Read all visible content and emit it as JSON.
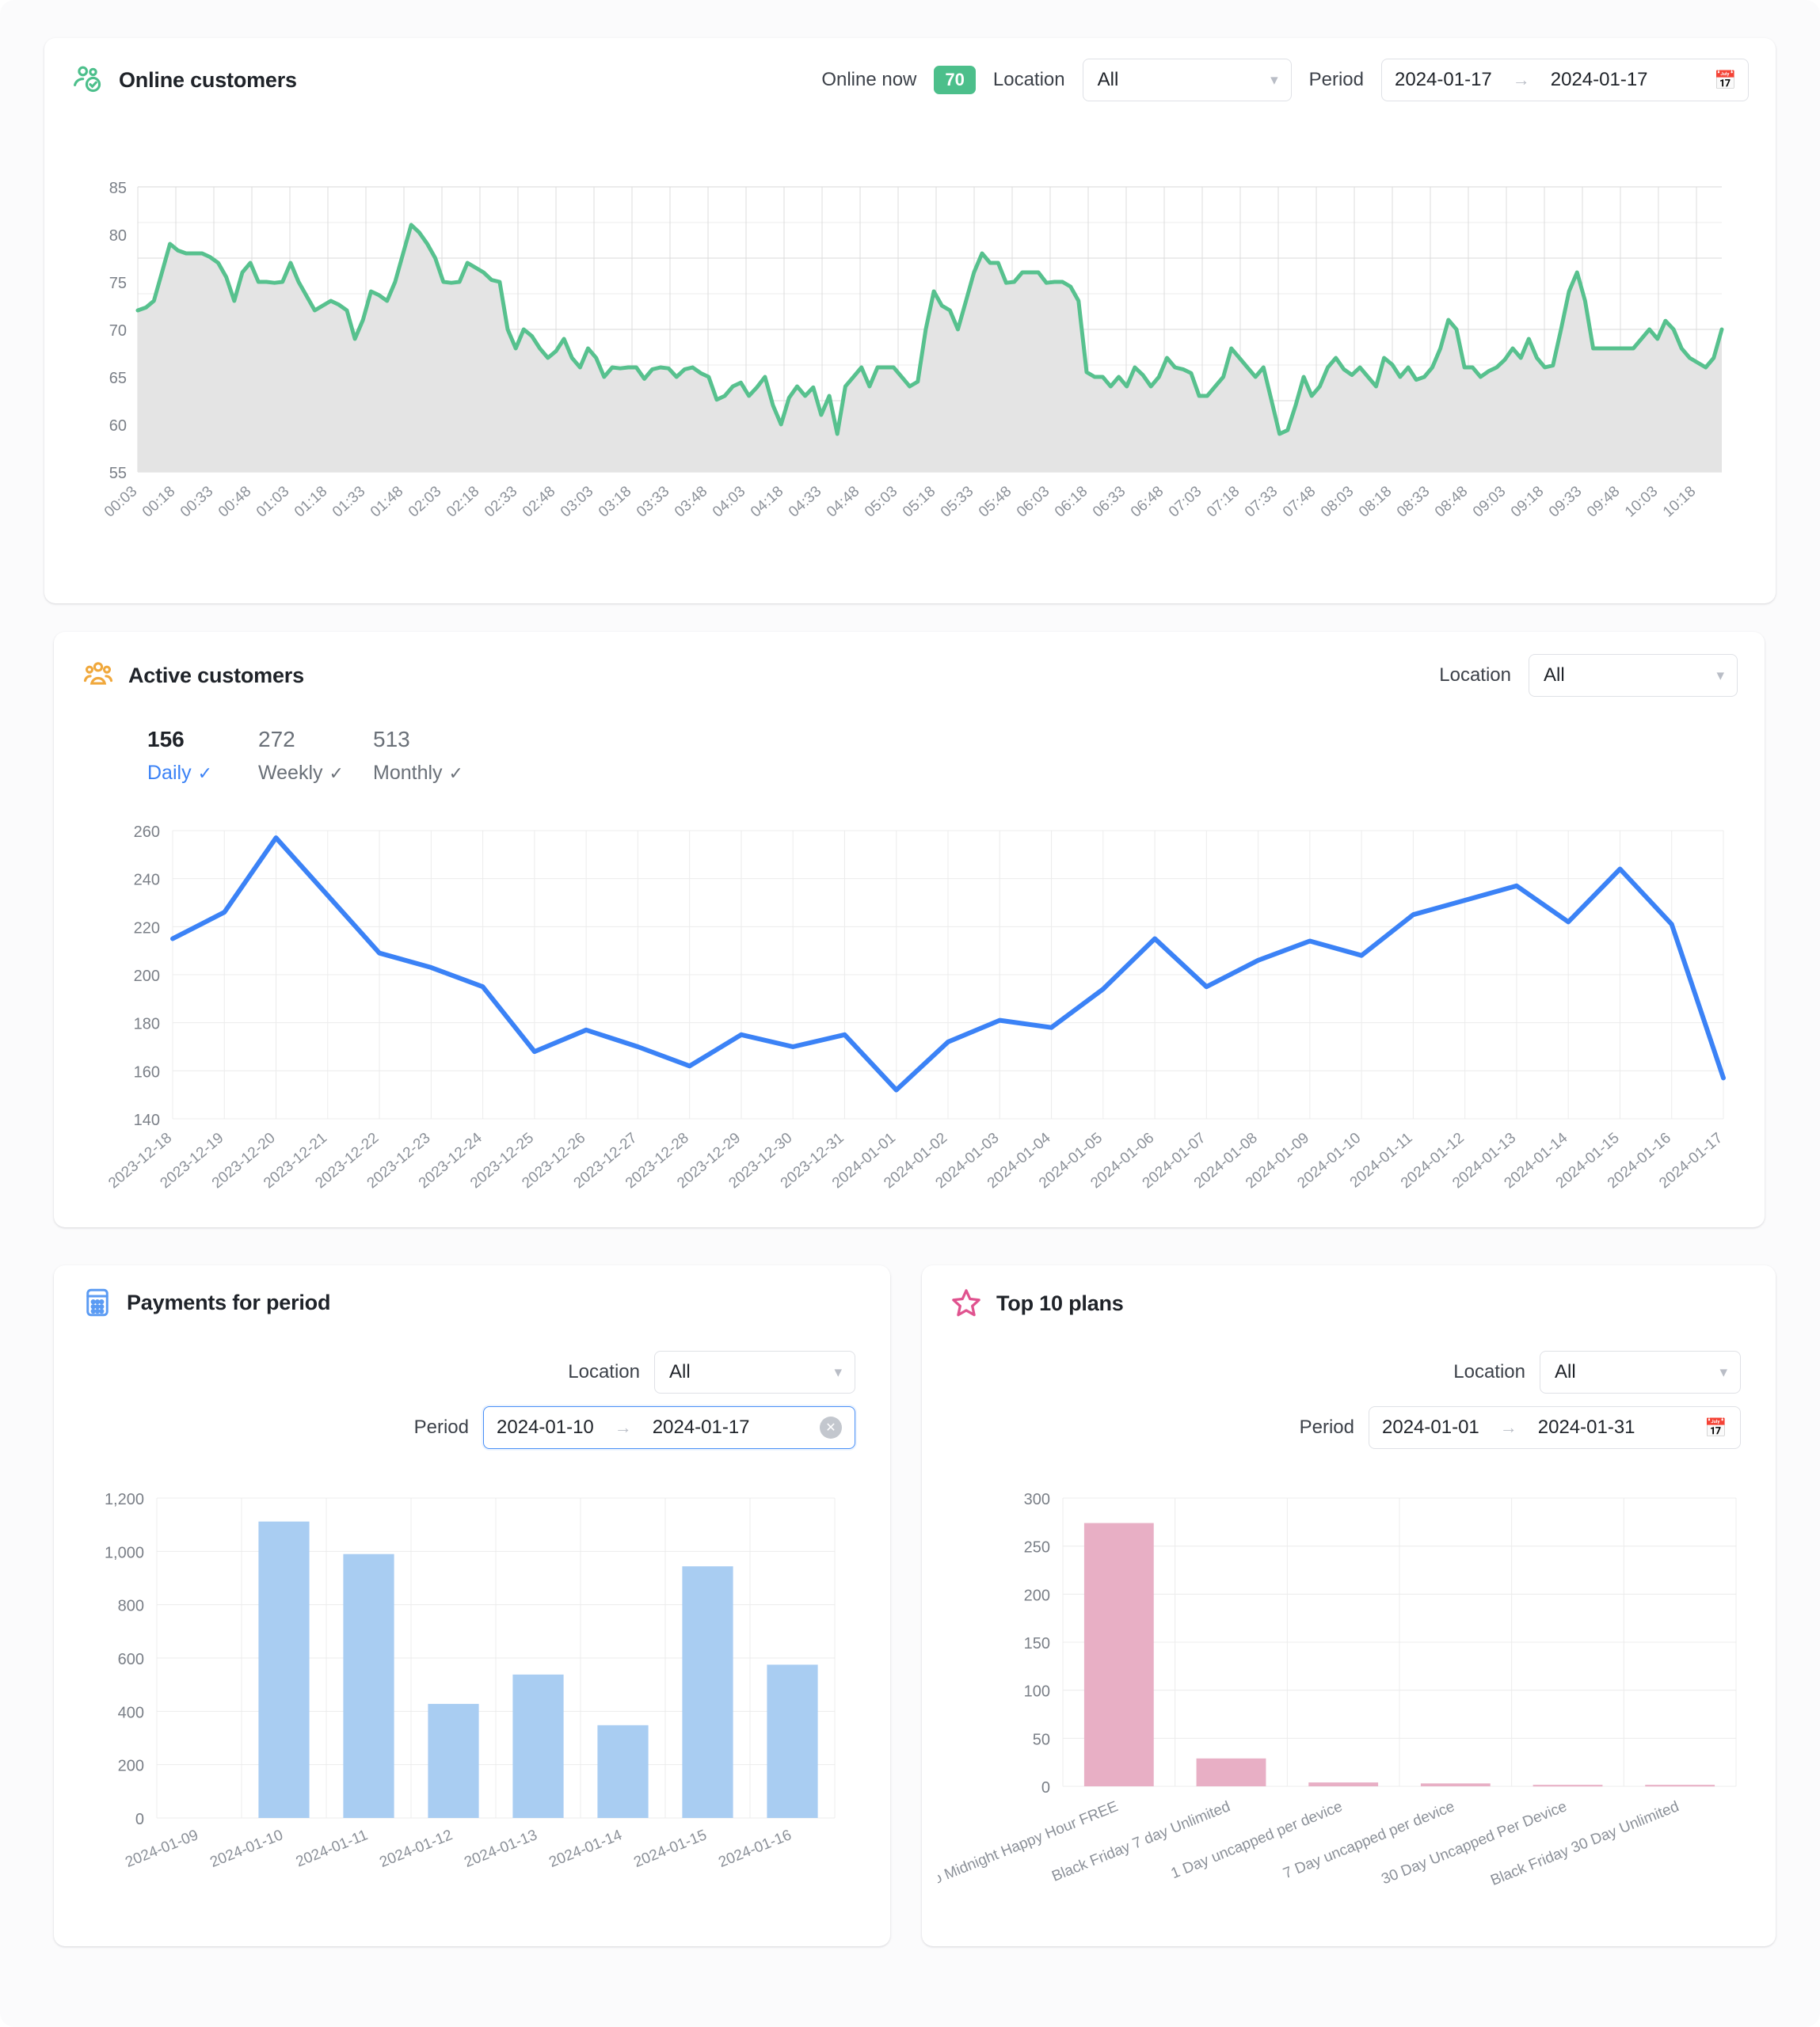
{
  "cards": {
    "online": {
      "title": "Online customers",
      "icon": "online-customers-icon",
      "online_now_label": "Online now",
      "online_now_value": "70",
      "location_label": "Location",
      "location_value": "All",
      "period_label": "Period",
      "period_start": "2024-01-17",
      "period_end": "2024-01-17",
      "accent": "#4cbf8b"
    },
    "active": {
      "title": "Active customers",
      "icon": "active-customers-icon",
      "location_label": "Location",
      "location_value": "All",
      "accent": "#f0a83c",
      "stats": [
        {
          "value": "156",
          "label": "Daily",
          "selected": true
        },
        {
          "value": "272",
          "label": "Weekly",
          "selected": false
        },
        {
          "value": "513",
          "label": "Monthly",
          "selected": false
        }
      ]
    },
    "payments": {
      "title": "Payments for period",
      "icon": "payments-calculator-icon",
      "location_label": "Location",
      "location_value": "All",
      "period_label": "Period",
      "period_start": "2024-01-10",
      "period_end": "2024-01-17",
      "accent": "#5b9bf3"
    },
    "plans": {
      "title": "Top 10 plans",
      "icon": "star-icon",
      "location_label": "Location",
      "location_value": "All",
      "period_label": "Period",
      "period_start": "2024-01-01",
      "period_end": "2024-01-31",
      "accent": "#e0538f"
    }
  },
  "chart_data": [
    {
      "id": "online_customers",
      "type": "area",
      "title": "Online customers",
      "xlabel": "",
      "ylabel": "",
      "ylim": [
        55,
        85
      ],
      "yticks": [
        55,
        60,
        65,
        70,
        75,
        80,
        85
      ],
      "grid": true,
      "color": "#57c18e",
      "fill": "#e4e4e4",
      "x": [
        "00:03",
        "00:08",
        "00:13",
        "00:18",
        "00:23",
        "00:28",
        "00:33",
        "00:38",
        "00:43",
        "00:48",
        "00:53",
        "00:58",
        "01:03",
        "01:08",
        "01:13",
        "01:18",
        "01:23",
        "01:28",
        "01:33",
        "01:38",
        "01:43",
        "01:48",
        "01:53",
        "01:58",
        "02:03",
        "02:08",
        "02:13",
        "02:18",
        "02:23",
        "02:28",
        "02:33",
        "02:38",
        "02:43",
        "02:48",
        "02:53",
        "02:58",
        "03:03",
        "03:08",
        "03:13",
        "03:18",
        "03:23",
        "03:28",
        "03:33",
        "03:38",
        "03:43",
        "03:48",
        "03:53",
        "03:58",
        "04:03",
        "04:08",
        "04:13",
        "04:18",
        "04:23",
        "04:28",
        "04:33",
        "04:38",
        "04:43",
        "04:48",
        "04:53",
        "04:58",
        "05:03",
        "05:08",
        "05:13",
        "05:18",
        "05:23",
        "05:28",
        "05:33",
        "05:38",
        "05:43",
        "05:48",
        "05:53",
        "05:58",
        "06:03",
        "06:08",
        "06:13",
        "06:18",
        "06:23",
        "06:28",
        "06:33",
        "06:38",
        "06:43",
        "06:48",
        "06:53",
        "06:58",
        "07:03",
        "07:08",
        "07:13",
        "07:18",
        "07:23",
        "07:28",
        "07:33",
        "07:38",
        "07:43",
        "07:48",
        "07:53",
        "07:58",
        "08:03",
        "08:08",
        "08:13",
        "08:18",
        "08:23",
        "08:28",
        "08:33",
        "08:38",
        "08:43",
        "08:48",
        "08:53",
        "08:58",
        "09:03",
        "09:08",
        "09:13",
        "09:18",
        "09:23",
        "09:28",
        "09:33",
        "09:38",
        "09:43",
        "09:48",
        "09:53",
        "09:58",
        "10:03",
        "10:08",
        "10:13",
        "10:18"
      ],
      "xticks": [
        "00:03",
        "00:18",
        "00:33",
        "00:48",
        "01:03",
        "01:18",
        "01:33",
        "01:48",
        "02:03",
        "02:18",
        "02:33",
        "02:48",
        "03:03",
        "03:18",
        "03:33",
        "03:48",
        "04:03",
        "04:18",
        "04:33",
        "04:48",
        "05:03",
        "05:18",
        "05:33",
        "05:48",
        "06:03",
        "06:18",
        "06:33",
        "06:48",
        "07:03",
        "07:18",
        "07:33",
        "07:48",
        "08:03",
        "08:18",
        "08:33",
        "08:48",
        "09:03",
        "09:18",
        "09:33",
        "09:48",
        "10:03",
        "10:18"
      ],
      "values": [
        72,
        72.3,
        73,
        76,
        79,
        78.3,
        78,
        78,
        78,
        77.6,
        77,
        75.5,
        73,
        76,
        77,
        75,
        75,
        74.9,
        75,
        77,
        75,
        73.5,
        72,
        72.5,
        73,
        72.6,
        72,
        69,
        71,
        74,
        73.6,
        73,
        75,
        78,
        81,
        80.2,
        79,
        77.5,
        75,
        74.9,
        75,
        77,
        76.5,
        76,
        75.2,
        75,
        70,
        68,
        70,
        69.3,
        68,
        67,
        67.7,
        69,
        67,
        66,
        68,
        67,
        65,
        66,
        65.9,
        66,
        66,
        64.8,
        65.8,
        66,
        65.9,
        65,
        65.8,
        66,
        65.4,
        65,
        62.6,
        63,
        64,
        64.4,
        63,
        63.9,
        65,
        62,
        60,
        62.8,
        64,
        63,
        63.9,
        61,
        63,
        59,
        64,
        65,
        66,
        64,
        66,
        66,
        66,
        65,
        64,
        64.5,
        70,
        74,
        72.5,
        72,
        70,
        73,
        76,
        78,
        77,
        77,
        74.9,
        75,
        76,
        76,
        76,
        74.9,
        75,
        75,
        74.5,
        73,
        65.5,
        65,
        65,
        64,
        65,
        64,
        66,
        65.2,
        64,
        65,
        67,
        66,
        65.8,
        65.4,
        63,
        63,
        64,
        65,
        68,
        67,
        66,
        65,
        66,
        62.5,
        59,
        59.4,
        62,
        65,
        63,
        64,
        66,
        67,
        65.8,
        65.2,
        66,
        65,
        64,
        67,
        66.3,
        65,
        66,
        64.7,
        65,
        66,
        68,
        71,
        70,
        66,
        66,
        65,
        65.6,
        66,
        66.8,
        68,
        67,
        69,
        67,
        66,
        66.2,
        70,
        74,
        76,
        73,
        68,
        68,
        68,
        68,
        68,
        68,
        69,
        70,
        69,
        70.9,
        70,
        68,
        67,
        66.5,
        66,
        67,
        70
      ],
      "series_note": "one point per minute-ish sample; ticks every 15 min"
    },
    {
      "id": "active_customers",
      "type": "line",
      "title": "Active customers",
      "xlabel": "",
      "ylabel": "",
      "ylim": [
        140,
        260
      ],
      "yticks": [
        140,
        160,
        180,
        200,
        220,
        240,
        260
      ],
      "grid": true,
      "color": "#3b82f6",
      "categories": [
        "2023-12-18",
        "2023-12-19",
        "2023-12-20",
        "2023-12-21",
        "2023-12-22",
        "2023-12-23",
        "2023-12-24",
        "2023-12-25",
        "2023-12-26",
        "2023-12-27",
        "2023-12-28",
        "2023-12-29",
        "2023-12-30",
        "2023-12-31",
        "2024-01-01",
        "2024-01-02",
        "2024-01-03",
        "2024-01-04",
        "2024-01-05",
        "2024-01-06",
        "2024-01-07",
        "2024-01-08",
        "2024-01-09",
        "2024-01-10",
        "2024-01-11",
        "2024-01-12",
        "2024-01-13",
        "2024-01-14",
        "2024-01-15",
        "2024-01-16",
        "2024-01-17"
      ],
      "values": [
        215,
        226,
        257,
        233,
        209,
        203,
        195,
        168,
        177,
        170,
        162,
        175,
        170,
        175,
        152,
        172,
        181,
        178,
        194,
        215,
        195,
        206,
        214,
        208,
        225,
        231,
        237,
        222,
        244,
        221,
        157
      ]
    },
    {
      "id": "payments_for_period",
      "type": "bar",
      "title": "Payments for period",
      "xlabel": "",
      "ylabel": "",
      "ylim": [
        0,
        1200
      ],
      "yticks": [
        "0",
        "200",
        "400",
        "600",
        "800",
        "1,000",
        "1,200"
      ],
      "grid": true,
      "color": "#a9cdf2",
      "categories": [
        "2024-01-09",
        "2024-01-10",
        "2024-01-11",
        "2024-01-12",
        "2024-01-13",
        "2024-01-14",
        "2024-01-15",
        "2024-01-16"
      ],
      "values": [
        0,
        1112,
        990,
        428,
        538,
        348,
        944,
        575
      ]
    },
    {
      "id": "top_10_plans",
      "type": "bar",
      "title": "Top 10 plans",
      "xlabel": "",
      "ylabel": "",
      "ylim": [
        0,
        300
      ],
      "yticks": [
        "0",
        "50",
        "100",
        "150",
        "200",
        "250",
        "300"
      ],
      "grid": true,
      "color": "#e8afc5",
      "categories": [
        "KaKo Midnight Happy Hour FREE",
        "Black Friday 7 day Unlimited",
        "1 Day uncapped per device",
        "7 Day uncapped per device",
        "30 Day Uncapped Per Device",
        "Black Friday 30 Day Unlimited"
      ],
      "values": [
        274,
        29,
        4,
        3,
        1.5,
        1.5
      ]
    }
  ]
}
